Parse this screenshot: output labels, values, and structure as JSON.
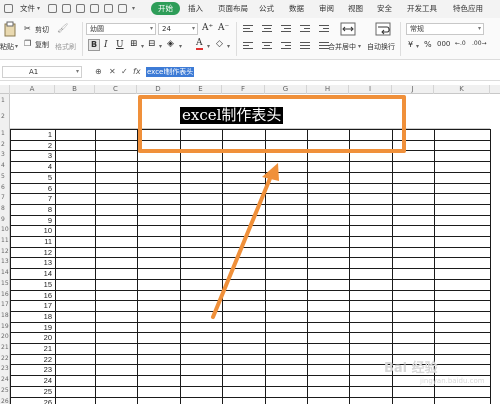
{
  "menu": {
    "file": "文件",
    "tabs": [
      "开始",
      "插入",
      "页面布局",
      "公式",
      "数据",
      "审阅",
      "视图",
      "安全",
      "开发工具",
      "特色应用"
    ],
    "active_tab": "开始"
  },
  "ribbon": {
    "cut": "剪切",
    "copy": "复制",
    "paste": "粘贴",
    "format_painter": "格式刷",
    "font_name": "幼圆",
    "font_size": "24",
    "merge_center": "合并居中",
    "wrap_text": "自动换行",
    "number_format": "常规",
    "bold": "B"
  },
  "formula_bar": {
    "cell_ref": "A1",
    "fx": "fx",
    "cancel": "✕",
    "confirm": "✓",
    "content": "excel制作表头"
  },
  "columns": [
    "A",
    "B",
    "C",
    "D",
    "E",
    "F",
    "G",
    "H",
    "I",
    "J",
    "K"
  ],
  "row_numbers": [
    "1",
    "2",
    "3",
    "4",
    "5",
    "6",
    "7",
    "8",
    "9",
    "10",
    "11",
    "12",
    "13",
    "14",
    "15",
    "16",
    "17",
    "18",
    "19",
    "20",
    "21",
    "22",
    "23",
    "24",
    "25",
    "26"
  ],
  "header_rows": [
    "1",
    "2"
  ],
  "sheet": {
    "title": "excel制作表头",
    "numbers": [
      "1",
      "2",
      "3",
      "4",
      "5",
      "6",
      "7",
      "8",
      "9",
      "10",
      "11",
      "12",
      "13",
      "14",
      "15",
      "16",
      "17",
      "18",
      "19",
      "20",
      "21",
      "22",
      "23",
      "24",
      "25",
      "26"
    ]
  },
  "watermark": {
    "main": "Bai 经验",
    "sub": "jingyan.baidu.com"
  },
  "colors": {
    "accent": "#2e9d58",
    "highlight": "#f0903a",
    "selection": "#3d7bd6"
  }
}
